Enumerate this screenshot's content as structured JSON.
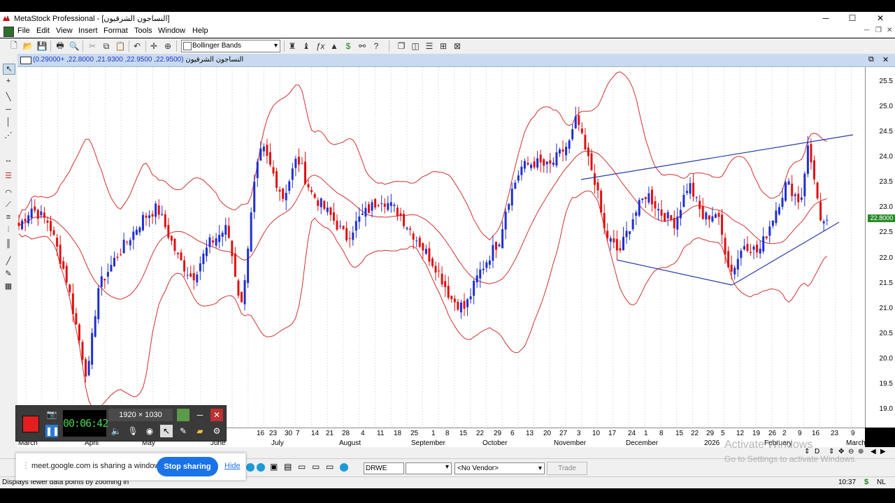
{
  "window": {
    "title": "MetaStock Professional - [النساجون الشرقيون]",
    "minimize": "─",
    "maximize": "☐",
    "close": "✕"
  },
  "menu": [
    "File",
    "Edit",
    "View",
    "Insert",
    "Format",
    "Tools",
    "Window",
    "Help"
  ],
  "toolbar": {
    "indicator": "Bollinger Bands"
  },
  "chart": {
    "name": "النساجون الشرقيون",
    "ohlc": "(22.9500, 22.9500, 21.9300, 22.8000, +0.29000)",
    "last_price": "22.8000",
    "y_ticks": [
      "25.5",
      "25.0",
      "24.5",
      "24.0",
      "23.5",
      "23.0",
      "22.5",
      "22.0",
      "21.5",
      "21.0",
      "20.5",
      "20.0",
      "19.5",
      "19.0"
    ],
    "x_days": [
      "16",
      "23",
      "30",
      "7",
      "14",
      "21",
      "28",
      "4",
      "11",
      "18",
      "25",
      "1",
      "8",
      "15",
      "22",
      "29",
      "6",
      "13",
      "20",
      "27",
      "3",
      "10",
      "17",
      "24",
      "1",
      "8",
      "15",
      "22",
      "29",
      "5",
      "12",
      "19",
      "26",
      "2",
      "9",
      "16",
      "23",
      "9"
    ],
    "x_months": [
      "March",
      "April",
      "May",
      "June",
      "July",
      "August",
      "September",
      "October",
      "November",
      "December",
      "2026",
      "February",
      "March"
    ],
    "colors": {
      "up": "#1f2fd0",
      "down": "#e01010",
      "bands": "#d03030",
      "trendline": "#2a3aa8"
    }
  },
  "recorder": {
    "time": "00:06:42",
    "resolution": "1920 × 1030"
  },
  "share": {
    "message": "meet.google.com is sharing a window.",
    "stop_label": "Stop sharing",
    "hide_label": "Hide"
  },
  "bottom": {
    "symbol": "DRWE",
    "vendor": "<No Vendor>",
    "trade": "Trade"
  },
  "status": {
    "text": "Displays fewer data points by zooming in",
    "time": "10:37",
    "lang": "NL"
  },
  "watermark": {
    "line1": "Activate Windows",
    "line2": "Go to Settings to activate Windows."
  }
}
